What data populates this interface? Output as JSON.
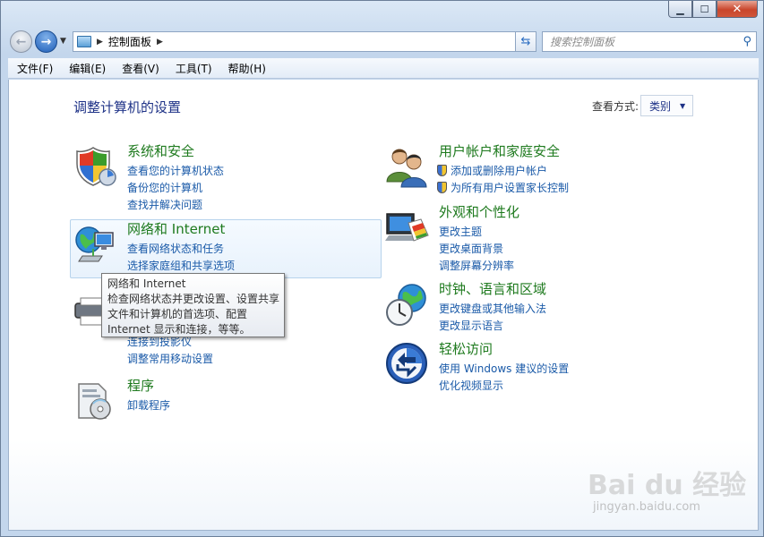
{
  "window": {
    "minimize": "▁",
    "maximize": "☐",
    "close": "✕"
  },
  "navbar": {
    "back": "←",
    "forward": "→",
    "address": "控制面板",
    "search_placeholder": "搜索控制面板"
  },
  "menubar": {
    "items": [
      "文件(F)",
      "编辑(E)",
      "查看(V)",
      "工具(T)",
      "帮助(H)"
    ]
  },
  "main": {
    "title": "调整计算机的设置",
    "view_by_label": "查看方式:",
    "view_by_value": "类别"
  },
  "categories": {
    "system": {
      "title": "系统和安全",
      "links": [
        "查看您的计算机状态",
        "备份您的计算机",
        "查找并解决问题"
      ]
    },
    "network": {
      "title": "网络和 Internet",
      "links": [
        "查看网络状态和任务",
        "选择家庭组和共享选项"
      ]
    },
    "hardware": {
      "links": [
        "连接到投影仪",
        "调整常用移动设置"
      ]
    },
    "programs": {
      "title": "程序",
      "links": [
        "卸载程序"
      ]
    },
    "users": {
      "title": "用户帐户和家庭安全",
      "links": [
        "添加或删除用户帐户",
        "为所有用户设置家长控制"
      ]
    },
    "appearance": {
      "title": "外观和个性化",
      "links": [
        "更改主题",
        "更改桌面背景",
        "调整屏幕分辨率"
      ]
    },
    "clock": {
      "title": "时钟、语言和区域",
      "links": [
        "更改键盘或其他输入法",
        "更改显示语言"
      ]
    },
    "ease": {
      "title": "轻松访问",
      "links": [
        "使用 Windows 建议的设置",
        "优化视频显示"
      ]
    }
  },
  "tooltip": {
    "lines": [
      "网络和 Internet",
      "检查网络状态并更改设置、设置共享",
      "文件和计算机的首选项、配置",
      "Internet 显示和连接，等等。"
    ]
  },
  "watermark": {
    "brand": "Bai du 经验",
    "url": "jingyan.baidu.com"
  }
}
